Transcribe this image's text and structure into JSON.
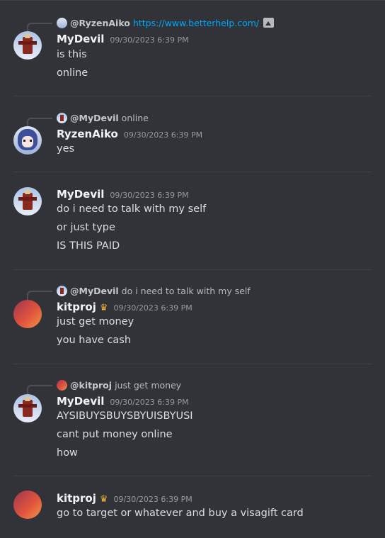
{
  "messages": [
    {
      "reply": {
        "name": "@RyzenAiko",
        "text": "",
        "link": "https://www.betterhelp.com/",
        "has_image": true
      },
      "author": "MyDevil",
      "timestamp": "09/30/2023 6:39 PM",
      "crown": false,
      "lines": [
        "is this",
        "online"
      ]
    },
    {
      "reply": {
        "name": "@MyDevil",
        "text": "online"
      },
      "author": "RyzenAiko",
      "timestamp": "09/30/2023 6:39 PM",
      "crown": false,
      "lines": [
        "yes"
      ]
    },
    {
      "author": "MyDevil",
      "timestamp": "09/30/2023 6:39 PM",
      "crown": false,
      "lines": [
        "do i need to talk with my self",
        "or just type",
        "IS THIS PAID"
      ]
    },
    {
      "reply": {
        "name": "@MyDevil",
        "text": "do i need to talk with my self"
      },
      "author": "kitproj",
      "timestamp": "09/30/2023 6:39 PM",
      "crown": true,
      "lines": [
        "just get money",
        "you have cash"
      ]
    },
    {
      "reply": {
        "name": "@kitproj",
        "text": "just get money"
      },
      "author": "MyDevil",
      "timestamp": "09/30/2023 6:39 PM",
      "crown": false,
      "lines": [
        "AYSIBUYSBUYSBYUISBYUSI",
        "cant put money online",
        "how"
      ]
    },
    {
      "author": "kitproj",
      "timestamp": "09/30/2023 6:39 PM",
      "crown": true,
      "lines": [
        "go to target or whatever and buy a visagift card"
      ]
    }
  ],
  "colors": {
    "background": "#313338",
    "username": "#f2f3f5",
    "timestamp": "#949ba4",
    "link": "#00a8fc",
    "crown": "#f0b232"
  }
}
